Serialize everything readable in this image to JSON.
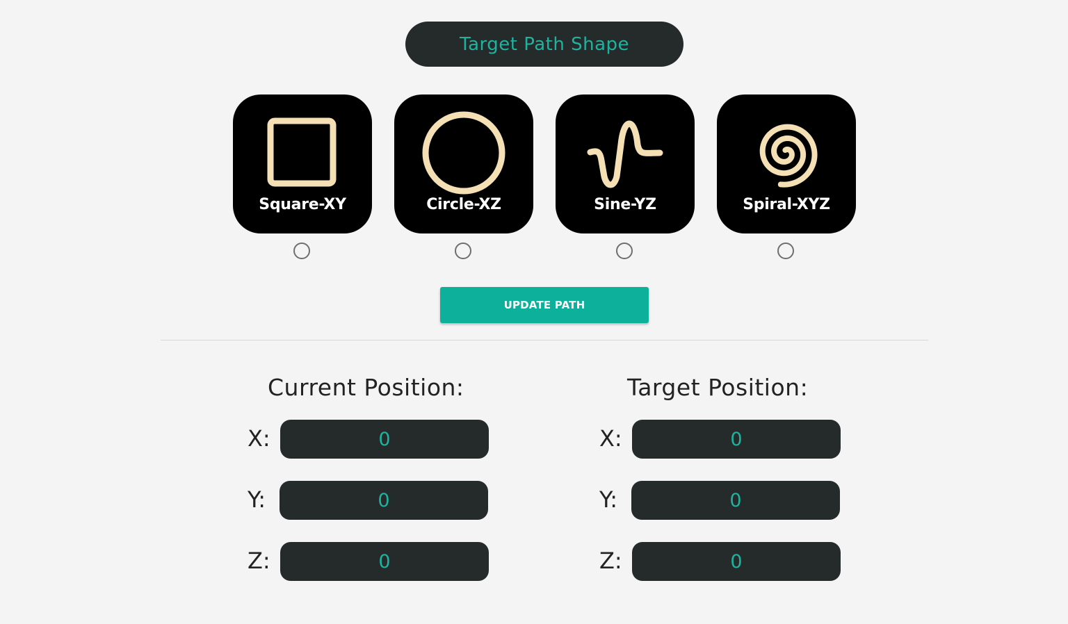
{
  "header": {
    "title": "Target Path Shape"
  },
  "shapes": [
    {
      "label": "Square-XY",
      "icon": "square-icon"
    },
    {
      "label": "Circle-XZ",
      "icon": "circle-icon"
    },
    {
      "label": "Sine-YZ",
      "icon": "sine-wave-icon"
    },
    {
      "label": "Spiral-XYZ",
      "icon": "spiral-icon"
    }
  ],
  "actions": {
    "update_label": "UPDATE PATH"
  },
  "current": {
    "heading": "Current Position:",
    "x_label": "X:",
    "x_value": "0",
    "y_label": "Y:",
    "y_value": "0",
    "z_label": "Z:",
    "z_value": "0"
  },
  "target": {
    "heading": "Target Position:",
    "x_label": "X:",
    "x_value": "0",
    "y_label": "Y:",
    "y_value": "0",
    "z_label": "Z:",
    "z_value": "0"
  },
  "colors": {
    "accent": "#0db09b",
    "value_text": "#1fb39f",
    "dark_panel": "#252a2b",
    "icon_stroke": "#f5dfb4",
    "background": "#f4f4f4"
  }
}
